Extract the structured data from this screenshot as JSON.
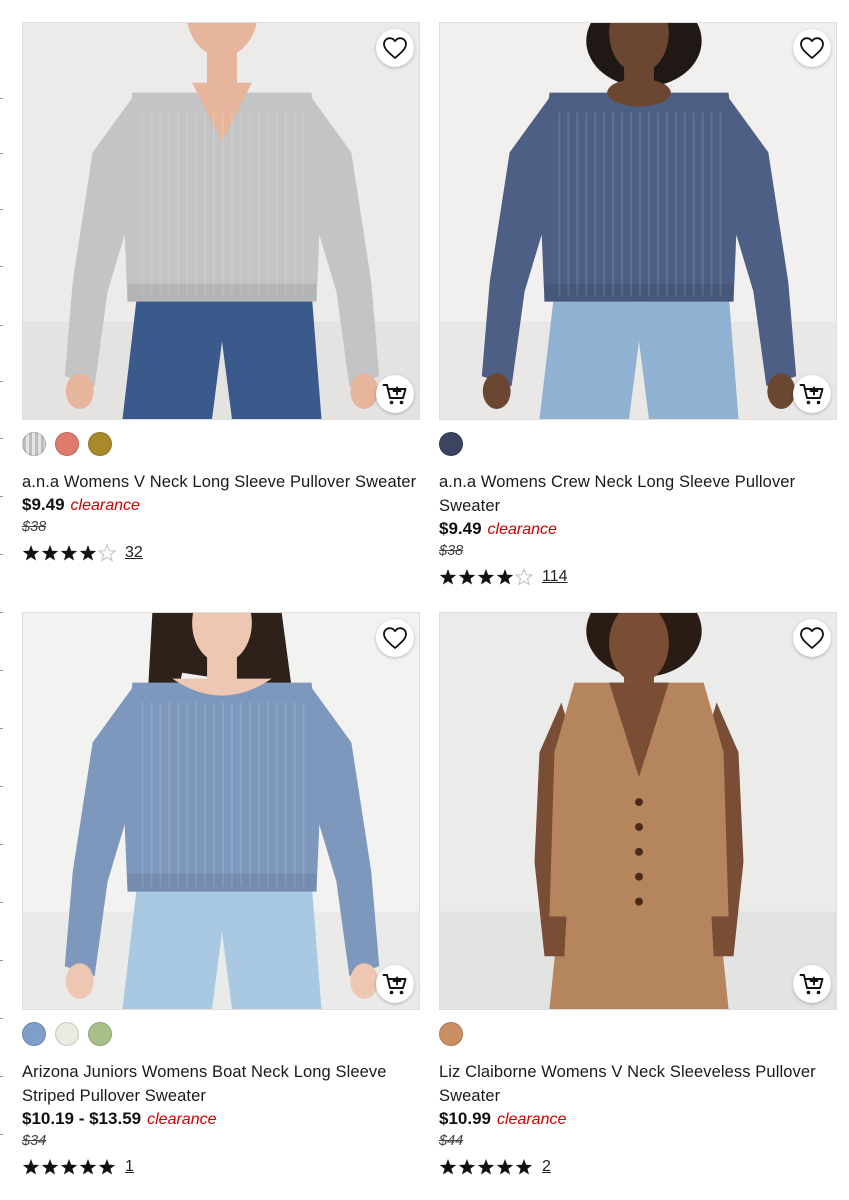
{
  "products": [
    {
      "name": "a.n.a Womens V Neck Long Sleeve Pullover Sweater",
      "price": "$9.49",
      "badge": "clearance",
      "original_price": "$38",
      "rating": 4,
      "review_count": "32",
      "swatches": [
        "#c9c9c9",
        "#e07a6c",
        "#a98a2a"
      ],
      "image": {
        "bg": "#ecebea",
        "top": "#c2c4c5",
        "bottom": "#3a5a8c",
        "skin": "#e6b59b",
        "hair": "#4a3425",
        "neck": "v"
      }
    },
    {
      "name": "a.n.a Womens Crew Neck Long Sleeve Pullover Sweater",
      "price": "$9.49",
      "badge": "clearance",
      "original_price": "$38",
      "rating": 4,
      "review_count": "114",
      "swatches": [
        "#3b4561"
      ],
      "image": {
        "bg": "#f1f0ee",
        "top": "#4d5f85",
        "bottom": "#8fb2d2",
        "skin": "#6b4631",
        "hair": "#1f1814",
        "neck": "crew"
      }
    },
    {
      "name": "Arizona Juniors Womens Boat Neck Long Sleeve Striped Pullover Sweater",
      "price": "$10.19 - $13.59",
      "badge": "clearance",
      "original_price": "$34",
      "rating": 5,
      "review_count": "1",
      "swatches": [
        "#7e9fca",
        "#ecebe2",
        "#a9bf8a"
      ],
      "image": {
        "bg": "#f2f2f1",
        "top": "#7e98bd",
        "bottom": "#a9c9e3",
        "skin": "#edc7b1",
        "hair": "#2e211a",
        "neck": "boat"
      }
    },
    {
      "name": "Liz Claiborne Womens V Neck Sleeveless Pullover Sweater",
      "price": "$10.99",
      "badge": "clearance",
      "original_price": "$44",
      "rating": 5,
      "review_count": "2",
      "swatches": [
        "#c98f62"
      ],
      "image": {
        "bg": "#ebebea",
        "top": "#b5855e",
        "bottom": "#b5855e",
        "skin": "#7a4d35",
        "hair": "#2a1c14",
        "neck": "sleeveless"
      }
    }
  ],
  "colors": {
    "clearance": "#cc0000",
    "star_filled": "#111111",
    "star_empty": "#bdbdbd"
  }
}
